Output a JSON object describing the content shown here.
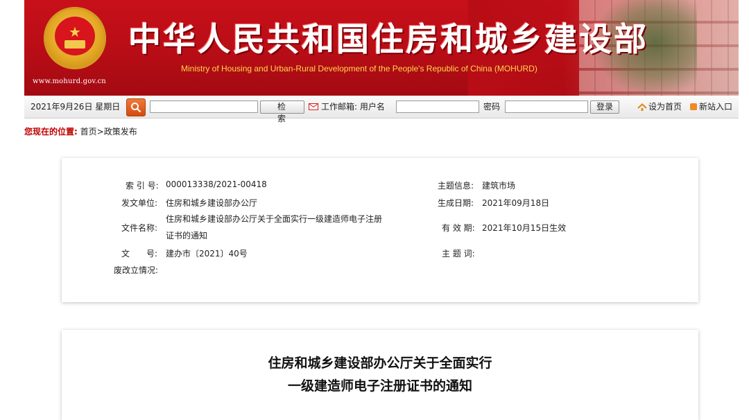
{
  "header": {
    "title": "中华人民共和国住房和城乡建设部",
    "subtitle_en": "Ministry of Housing and Urban-Rural Development of the People's Republic of China (MOHURD)",
    "site_url": "www.mohurd.gov.cn",
    "emblem_icon": "national-emblem-icon",
    "brand_color": "#b80d16"
  },
  "toolbar": {
    "date": "2021年9月26日 星期日",
    "search_value": "",
    "search_button": "检 索",
    "mailbox_label": "工作邮箱: 用户名",
    "username_value": "",
    "password_label": "密码",
    "password_value": "",
    "login_button": "登录",
    "set_home": "设为首页",
    "news_portal": "新站入口",
    "icons": [
      "search-icon",
      "mail-icon",
      "home-icon",
      "rss-icon"
    ]
  },
  "breadcrumb": {
    "label": "您现在的位置:",
    "path": "首页>政策发布",
    "label_color": "#c00000"
  },
  "info": {
    "index_label": "索 引 号:",
    "index_value": "000013338/2021-00418",
    "issuer_label": "发文单位:",
    "issuer_value": "住房和城乡建设部办公厅",
    "filename_label": "文件名称:",
    "filename_value": "住房和城乡建设部办公厅关于全面实行一级建造师电子注册证书的通知",
    "docno_label": "文　　号:",
    "docno_value": "建办市〔2021〕40号",
    "status_label": "废改立情况:",
    "status_value": "",
    "topic_label": "主题信息:",
    "topic_value": "建筑市场",
    "date_label": "生成日期:",
    "date_value": "2021年09月18日",
    "valid_label": "有 效 期:",
    "valid_value": "2021年10月15日生效",
    "keywords_label": "主 题 词:",
    "keywords_value": ""
  },
  "document": {
    "title_line1": "住房和城乡建设部办公厅关于全面实行",
    "title_line2": "一级建造师电子注册证书的通知"
  }
}
